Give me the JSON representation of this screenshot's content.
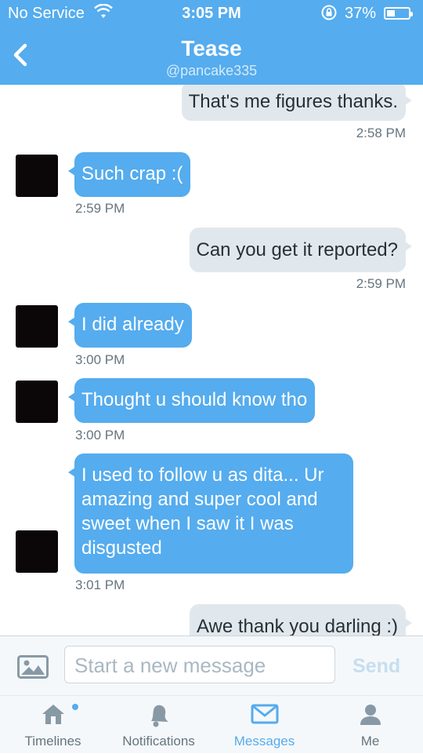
{
  "status_bar": {
    "carrier": "No Service",
    "time": "3:05 PM",
    "battery": "37%",
    "battery_level": 0.37
  },
  "header": {
    "title": "Tease",
    "handle": "@pancake335",
    "back_icon": "chevron-left-icon"
  },
  "messages": [
    {
      "direction": "out",
      "text": "That's me figures thanks.",
      "time": "2:58 PM"
    },
    {
      "direction": "in",
      "text": "Such crap :(",
      "time": "2:59 PM"
    },
    {
      "direction": "out",
      "text": "Can you get it reported?",
      "time": "2:59 PM"
    },
    {
      "direction": "in",
      "text": "I did already",
      "time": "3:00 PM"
    },
    {
      "direction": "in",
      "text": "Thought u should know tho",
      "time": "3:00 PM"
    },
    {
      "direction": "in",
      "text": "I used to follow u as dita... Ur amazing and super cool and sweet when I saw it I was disgusted",
      "time": "3:01 PM"
    },
    {
      "direction": "out",
      "text": "Awe thank you darling :)",
      "time": ""
    }
  ],
  "compose": {
    "placeholder": "Start a new message",
    "send_label": "Send"
  },
  "tabs": [
    {
      "label": "Timelines",
      "icon": "home-icon",
      "active": false,
      "badge": true
    },
    {
      "label": "Notifications",
      "icon": "bell-icon",
      "active": false
    },
    {
      "label": "Messages",
      "icon": "envelope-icon",
      "active": true
    },
    {
      "label": "Me",
      "icon": "person-icon",
      "active": false
    }
  ],
  "colors": {
    "accent": "#55acee",
    "outgoing_bubble": "#e1e8ed",
    "muted_text": "#66757f"
  }
}
